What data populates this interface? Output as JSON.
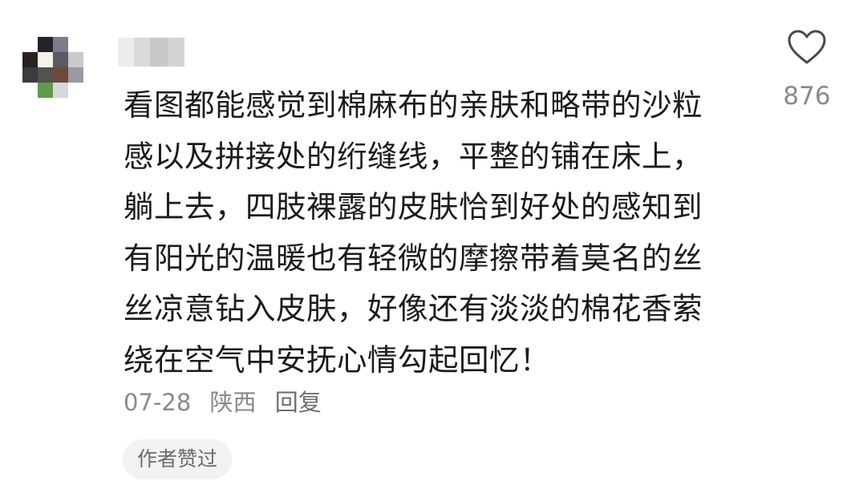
{
  "comment": {
    "lines": [
      "看图都能感觉到棉麻布的亲肤和略带的沙粒",
      "感以及拼接处的绗缝线，平整的铺在床上，",
      "躺上去，四肢裸露的皮肤恰到好处的感知到",
      "有阳光的温暖也有轻微的摩擦带着莫名的丝",
      "丝凉意钻入皮肤，好像还有淡淡的棉花香萦",
      "绕在空气中安抚心情勾起回忆！"
    ]
  },
  "meta": {
    "date": "07-28",
    "location": "陕西",
    "reply_label": "回复"
  },
  "badge": {
    "label": "作者赞过"
  },
  "like": {
    "icon": "heart-outline-icon",
    "count": "876"
  },
  "colors": {
    "text": "#1b1b1b",
    "meta": "#8a8a8a",
    "badge_bg": "#f2f2f2"
  }
}
